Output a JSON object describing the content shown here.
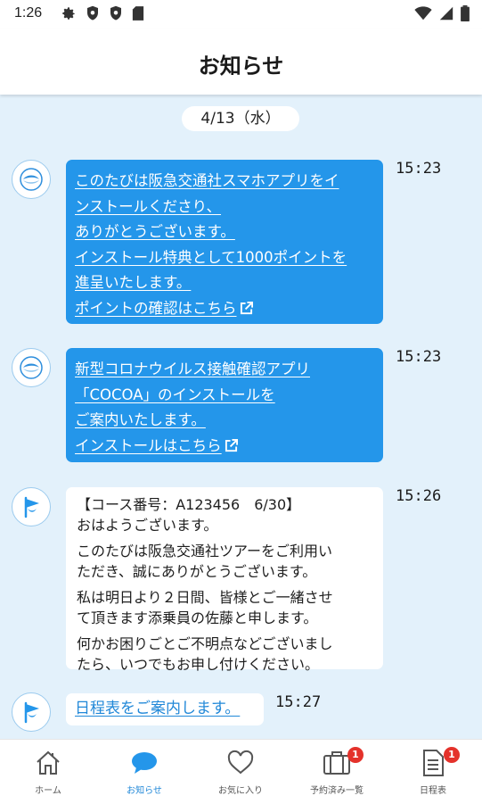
{
  "status_bar": {
    "time": "1:26"
  },
  "header": {
    "title": "お知らせ"
  },
  "feed": {
    "date_label": "4/13（水）",
    "messages": [
      {
        "lines": [
          "このたびは阪急交通社スマホアプリをイ",
          "ンストールくださり、",
          "ありがとうございます。",
          "インストール特典として1000ポイントを",
          "進呈いたします。",
          "ポイントの確認はこちら"
        ],
        "time": "15:23"
      },
      {
        "lines": [
          "新型コロナウイルス接触確認アプリ",
          "「COCOA」のインストールを",
          "ご案内いたします。",
          "インストールはこちら"
        ],
        "time": "15:23"
      },
      {
        "paragraphs": [
          [
            "【コース番号：A123456　6/30】",
            "おはようございます。"
          ],
          [
            "このたびは阪急交通社ツアーをご利用い",
            "ただき、誠にありがとうございます。"
          ],
          [
            "私は明日より２日間、皆様とご一緒させ",
            "て頂きます添乗員の佐藤と申します。"
          ],
          [
            "何かお困りごとご不明点などございまし",
            "たら、いつでもお申し付けください。"
          ]
        ],
        "time": "15:26"
      },
      {
        "text": "日程表をご案内します。",
        "time": "15:27"
      }
    ]
  },
  "bottom_nav": {
    "items": [
      {
        "label": "ホーム",
        "icon": "home-icon"
      },
      {
        "label": "お知らせ",
        "icon": "chat-bubble-icon"
      },
      {
        "label": "お気に入り",
        "icon": "heart-icon"
      },
      {
        "label": "予約済み一覧",
        "icon": "suitcase-icon",
        "badge": "1"
      },
      {
        "label": "日程表",
        "icon": "document-icon",
        "badge": "1"
      }
    ]
  },
  "colors": {
    "accent": "#2496ea",
    "background": "#e3f1fb",
    "badge": "#e4322b"
  }
}
